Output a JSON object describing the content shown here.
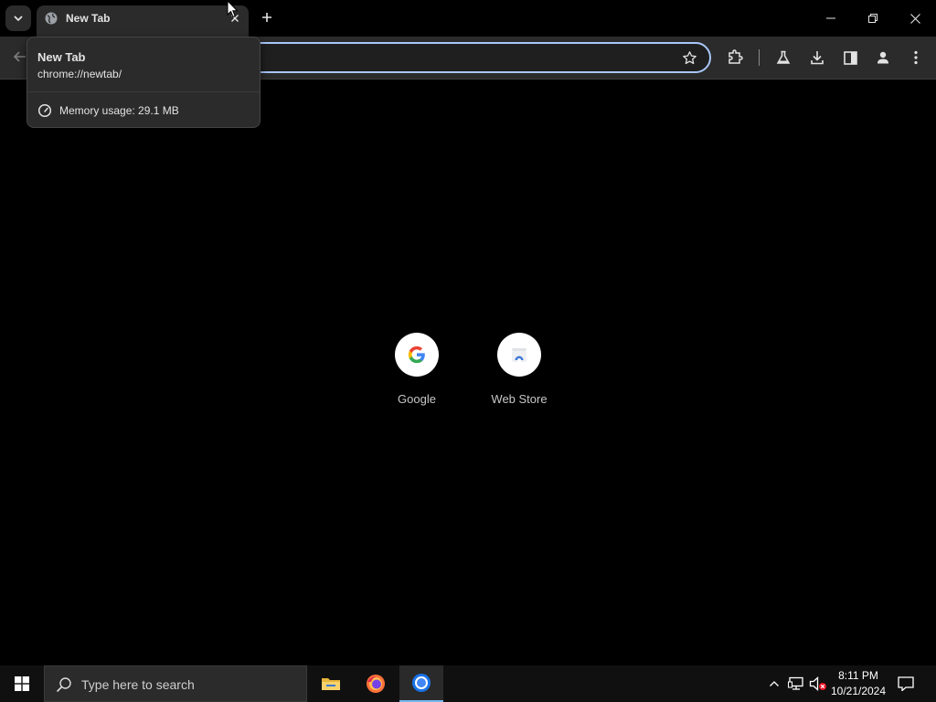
{
  "browser": {
    "tab": {
      "title": "New Tab"
    },
    "hovercard": {
      "title": "New Tab",
      "url": "chrome://newtab/",
      "memory": "Memory usage: 29.1 MB"
    },
    "accent_color": "#a8c7fa"
  },
  "newtab": {
    "shortcuts": [
      {
        "label": "Google",
        "icon": "google-logo-icon"
      },
      {
        "label": "Web Store",
        "icon": "web-store-icon"
      }
    ]
  },
  "taskbar": {
    "search_placeholder": "Type here to search",
    "apps": [
      "file-explorer-icon",
      "firefox-icon",
      "chrome-icon"
    ],
    "clock": {
      "time": "8:11 PM",
      "date": "10/21/2024"
    }
  }
}
